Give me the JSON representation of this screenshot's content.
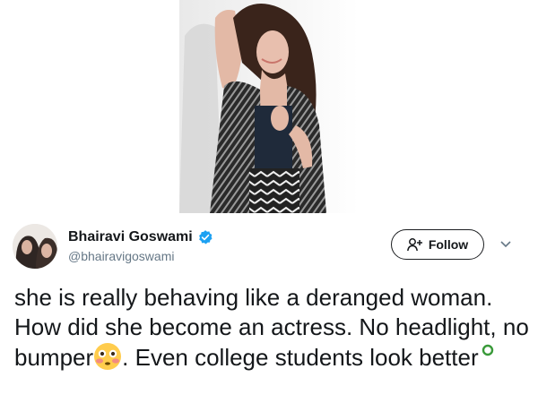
{
  "tweet": {
    "author": {
      "display_name": "Bhairavi Goswami",
      "handle": "@bhairavigoswami",
      "verified": true
    },
    "follow_button_label": "Follow",
    "text": {
      "part1": "she is really behaving like a deranged woman. How did she become an actress. No headlight, no bumper",
      "emoji1": "flushed-face",
      "part2": ". Even college students look better",
      "emoji2": "green-circle"
    }
  },
  "icons": {
    "verified": "verified-badge-icon",
    "follow": "add-user-icon",
    "menu": "chevron-down-icon"
  },
  "colors": {
    "text": "#14171a",
    "muted": "#657786",
    "verified": "#1da1f2",
    "button_border": "#1c1e21"
  }
}
